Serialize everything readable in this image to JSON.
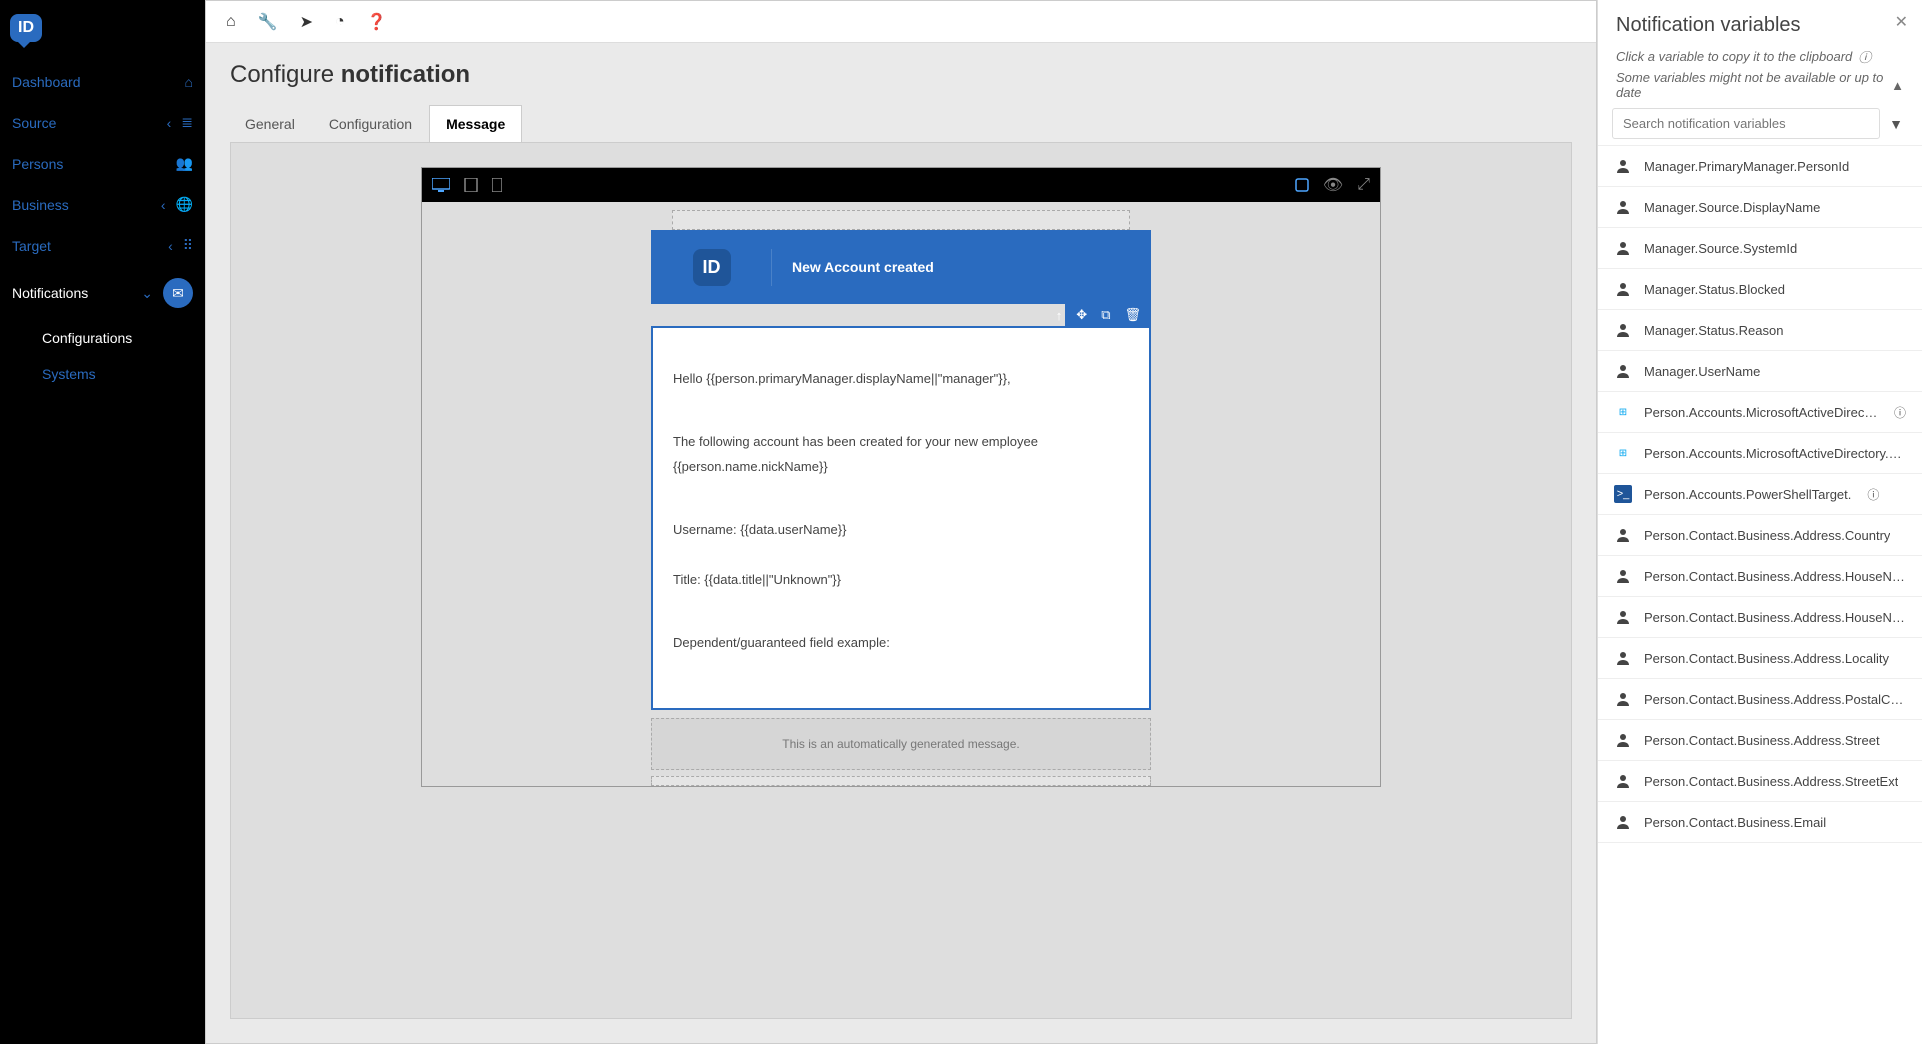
{
  "sidebar": {
    "items": [
      {
        "label": "Dashboard"
      },
      {
        "label": "Source"
      },
      {
        "label": "Persons"
      },
      {
        "label": "Business"
      },
      {
        "label": "Target"
      },
      {
        "label": "Notifications"
      }
    ],
    "subitems": [
      {
        "label": "Configurations"
      },
      {
        "label": "Systems"
      }
    ]
  },
  "page": {
    "title_light": "Configure ",
    "title_bold": "notification"
  },
  "tabs": [
    {
      "label": "General"
    },
    {
      "label": "Configuration"
    },
    {
      "label": "Message"
    }
  ],
  "email": {
    "subject": "New Account created",
    "body_line1": "Hello {{person.primaryManager.displayName||\"manager\"}},",
    "body_line2": "The following account has been created for your new employee {{person.name.nickName}}",
    "body_line3": "Username: {{data.userName}}",
    "body_line4": "Title: {{data.title||\"Unknown\"}}",
    "body_line5": "Dependent/guaranteed field example:",
    "footer": "This is an automatically generated message."
  },
  "panel": {
    "title": "Notification variables",
    "hint1": "Click a variable to copy it to the clipboard",
    "hint2": "Some variables might not be available or up to date",
    "search_placeholder": "Search notification variables",
    "variables": [
      {
        "icon": "person",
        "label": "Manager.PrimaryManager.PersonId"
      },
      {
        "icon": "person",
        "label": "Manager.Source.DisplayName"
      },
      {
        "icon": "person",
        "label": "Manager.Source.SystemId"
      },
      {
        "icon": "person",
        "label": "Manager.Status.Blocked"
      },
      {
        "icon": "person",
        "label": "Manager.Status.Reason"
      },
      {
        "icon": "person",
        "label": "Manager.UserName"
      },
      {
        "icon": "win",
        "label": "Person.Accounts.MicrosoftActiveDirectory.",
        "info": true
      },
      {
        "icon": "win",
        "label": "Person.Accounts.MicrosoftActiveDirectory.SamAcc..."
      },
      {
        "icon": "ps",
        "label": "Person.Accounts.PowerShellTarget.",
        "info": true
      },
      {
        "icon": "person",
        "label": "Person.Contact.Business.Address.Country"
      },
      {
        "icon": "person",
        "label": "Person.Contact.Business.Address.HouseNumber"
      },
      {
        "icon": "person",
        "label": "Person.Contact.Business.Address.HouseNumberExt"
      },
      {
        "icon": "person",
        "label": "Person.Contact.Business.Address.Locality"
      },
      {
        "icon": "person",
        "label": "Person.Contact.Business.Address.PostalCode"
      },
      {
        "icon": "person",
        "label": "Person.Contact.Business.Address.Street"
      },
      {
        "icon": "person",
        "label": "Person.Contact.Business.Address.StreetExt"
      },
      {
        "icon": "person",
        "label": "Person.Contact.Business.Email"
      }
    ]
  }
}
